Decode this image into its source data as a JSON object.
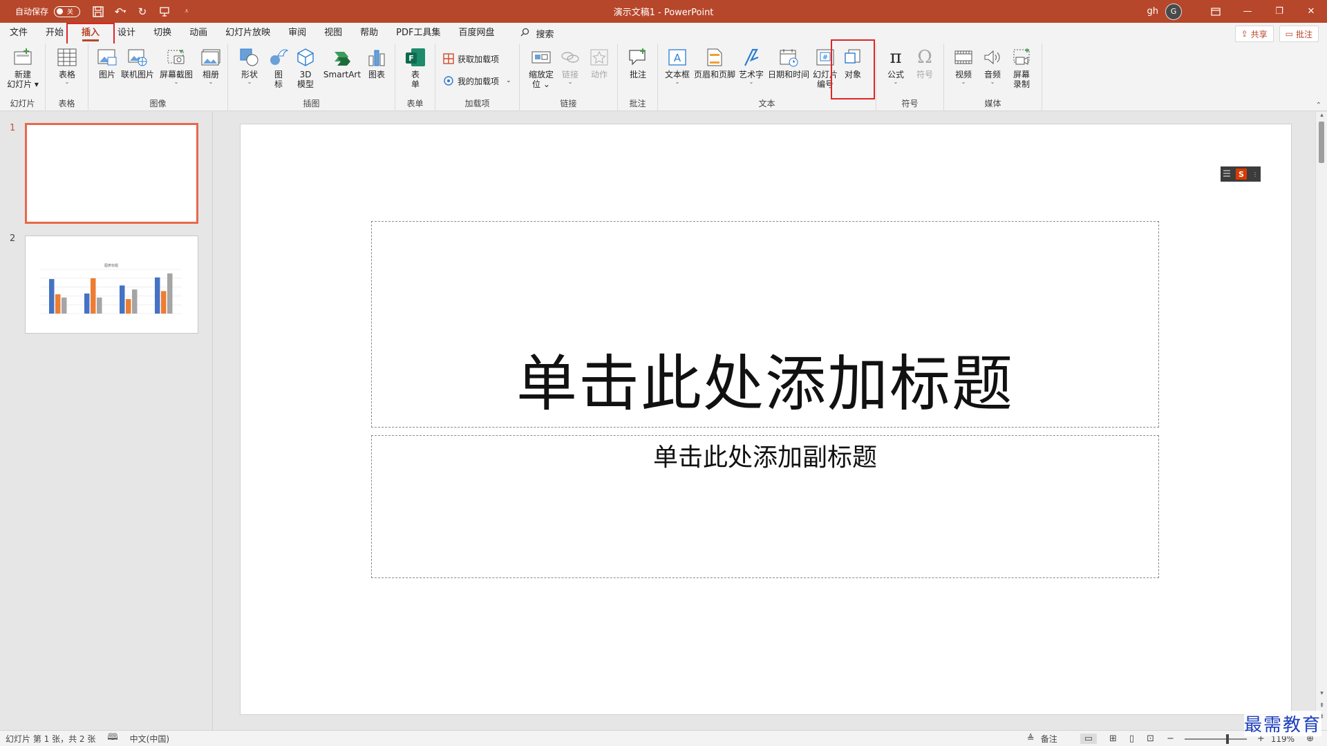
{
  "titlebar": {
    "autosave_label": "自动保存",
    "autosave_state": "关",
    "doc_title": "演示文稿1 - PowerPoint",
    "user_name": "gh",
    "avatar_initial": "G"
  },
  "tabs": [
    "文件",
    "开始",
    "插入",
    "设计",
    "切换",
    "动画",
    "幻灯片放映",
    "审阅",
    "视图",
    "帮助",
    "PDF工具集",
    "百度网盘"
  ],
  "active_tab": "插入",
  "search_label": "搜索",
  "share_label": "共享",
  "comment_label": "批注",
  "ribbon": {
    "groups": {
      "slides": "幻灯片",
      "tables": "表格",
      "images": "图像",
      "illustrations": "插图",
      "forms": "表单",
      "addins": "加载项",
      "links": "链接",
      "comments": "批注",
      "text": "文本",
      "symbols": "符号",
      "media": "媒体"
    },
    "buttons": {
      "new_slide_1": "新建",
      "new_slide_2": "幻灯片",
      "table": "表格",
      "picture": "图片",
      "online_picture": "联机图片",
      "screenshot": "屏幕截图",
      "album": "相册",
      "shapes": "形状",
      "icons_1": "图",
      "icons_2": "标",
      "model3d_1": "3D",
      "model3d_2": "模型",
      "smartart": "SmartArt",
      "chart": "图表",
      "form_1": "表",
      "form_2": "单",
      "get_addins": "获取加载项",
      "my_addins": "我的加载项",
      "zoom_1": "缩放定",
      "zoom_2": "位",
      "link": "链接",
      "action": "动作",
      "comment": "批注",
      "textbox": "文本框",
      "header_footer": "页眉和页脚",
      "wordart": "艺术字",
      "date_time": "日期和时间",
      "slide_num_1": "幻灯片",
      "slide_num_2": "编号",
      "object": "对象",
      "equation": "公式",
      "symbol": "符号",
      "video": "视频",
      "audio": "音频",
      "screen_rec_1": "屏幕",
      "screen_rec_2": "录制"
    }
  },
  "thumbnails": [
    {
      "number": "1",
      "selected": true
    },
    {
      "number": "2",
      "selected": false,
      "chart_title": "图表标题",
      "values": [
        [
          4.3,
          2.4,
          2.0
        ],
        [
          2.5,
          4.4,
          2.0
        ],
        [
          3.5,
          1.8,
          3.0
        ],
        [
          4.5,
          2.8,
          5.0
        ]
      ],
      "colors": [
        "#4472c4",
        "#ed7d31",
        "#a5a5a5"
      ]
    }
  ],
  "slide": {
    "title_placeholder": "单击此处添加标题",
    "subtitle_placeholder": "单击此处添加副标题"
  },
  "statusbar": {
    "slide_info": "幻灯片 第 1 张，共 2 张",
    "language": "中文(中国)",
    "notes": "备注",
    "zoom": "119%"
  },
  "watermark": "最需教育",
  "colors": {
    "accent": "#b7472a",
    "highlight_box": "#e02424",
    "selected_thumb": "#e5694c"
  }
}
